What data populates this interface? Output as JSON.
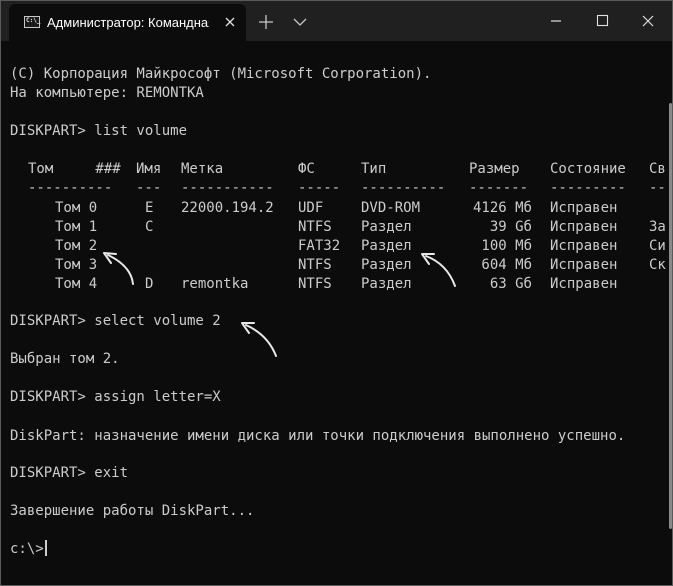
{
  "window": {
    "tab_title": "Администратор: Командная ст",
    "tab_icon_glyph": "C:\\_",
    "icons": [
      "terminal-icon",
      "close-icon",
      "plus-icon",
      "chevron-down-icon",
      "minimize-icon",
      "maximize-icon",
      "close-icon"
    ]
  },
  "console": {
    "copyright": "(C) Корпорация Майкрософт (Microsoft Corporation).",
    "computer": "На компьютере: REMONTKA",
    "cmd_list": "DISKPART> list volume",
    "table": {
      "headers": [
        "Том     ###",
        "Имя",
        "Метка",
        "ФС",
        "Тип",
        "Размер",
        "Состояние",
        "Св"
      ],
      "separators": [
        "----------",
        "---",
        "-----------",
        "-----",
        "----------",
        "-------",
        "---------",
        "--"
      ],
      "rows": [
        [
          "Том 0",
          "E",
          "22000.194.2",
          "UDF",
          "DVD-ROM",
          "4126 Мб",
          "Исправен",
          ""
        ],
        [
          "Том 1",
          "C",
          "",
          "NTFS",
          "Раздел",
          "39 Gб",
          "Исправен",
          "За"
        ],
        [
          "Том 2",
          "",
          "",
          "FAT32",
          "Раздел",
          "100 Мб",
          "Исправен",
          "Си"
        ],
        [
          "Том 3",
          "",
          "",
          "NTFS",
          "Раздел",
          "604 Мб",
          "Исправен",
          "Ск"
        ],
        [
          "Том 4",
          "D",
          "remontka",
          "NTFS",
          "Раздел",
          "63 Gб",
          "Исправен",
          ""
        ]
      ]
    },
    "cmd_select": "DISKPART> select volume 2",
    "select_result": "Выбран том 2.",
    "cmd_assign": "DISKPART> assign letter=X",
    "assign_result": "DiskPart: назначение имени диска или точки подключения выполнено успешно.",
    "cmd_exit": "DISKPART> exit",
    "exit_result": "Завершение работы DiskPart...",
    "prompt": "c:\\>"
  },
  "colors": {
    "background": "#0c0c0c",
    "titlebar": "#202020",
    "text": "#cccccc"
  }
}
